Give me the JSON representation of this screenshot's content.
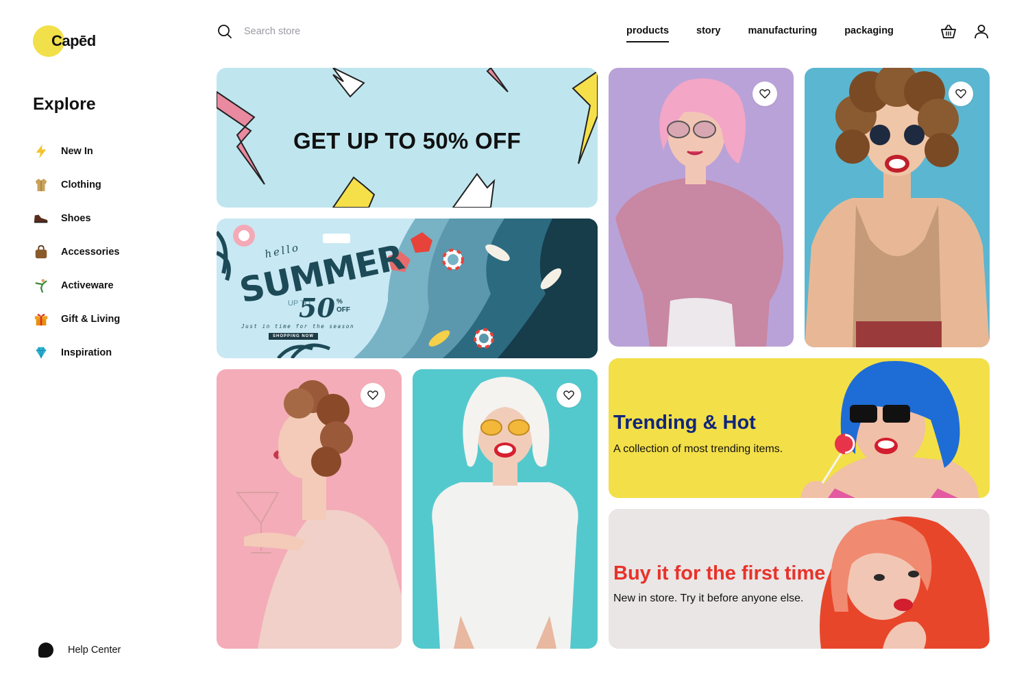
{
  "brand": {
    "logo_text": "Capēd",
    "accent_color": "#f2e04a"
  },
  "sidebar": {
    "heading": "Explore",
    "items": [
      {
        "label": "New In",
        "icon": "lightning-icon"
      },
      {
        "label": "Clothing",
        "icon": "coat-icon"
      },
      {
        "label": "Shoes",
        "icon": "shoe-icon"
      },
      {
        "label": "Accessories",
        "icon": "handbag-icon"
      },
      {
        "label": "Activeware",
        "icon": "gymnast-icon"
      },
      {
        "label": "Gift & Living",
        "icon": "gift-icon"
      },
      {
        "label": "Inspiration",
        "icon": "gem-icon"
      }
    ],
    "help": {
      "label": "Help Center",
      "icon": "chat-bubble-icon"
    }
  },
  "header": {
    "search": {
      "placeholder": "Search store",
      "value": ""
    },
    "nav": [
      {
        "label": "products",
        "active": true
      },
      {
        "label": "story",
        "active": false
      },
      {
        "label": "manufacturing",
        "active": false
      },
      {
        "label": "packaging",
        "active": false
      }
    ],
    "icons": [
      "basket-icon",
      "user-icon"
    ]
  },
  "banners": {
    "sale": {
      "title": "GET UP TO 50% OFF",
      "bg": "#bfe6ef"
    },
    "summer": {
      "hello": "hello",
      "title": "SUMMER",
      "upto": "UP TO",
      "percent": "50",
      "percent_sign": "%",
      "off": "OFF",
      "subtitle": "Just in time for the season",
      "cta": "SHOPPING NOW"
    },
    "trending": {
      "title": "Trending & Hot",
      "subtitle": "A collection of most trending items.",
      "title_color": "#10267a",
      "bg": "#f3df48"
    },
    "first_time": {
      "title": "Buy it for the first time",
      "subtitle": "New in store. Try it before anyone else.",
      "title_color": "#e8322a",
      "bg": "#e9e6e5"
    }
  },
  "products": [
    {
      "name": "pink-bob-sweater",
      "bg": "#b9a2d8"
    },
    {
      "name": "curly-hair-sequin-top",
      "bg": "#5bb6d1"
    },
    {
      "name": "pink-satin-robe",
      "bg": "#f4acb8"
    },
    {
      "name": "white-bob-tshirt",
      "bg": "#54c9cd"
    }
  ]
}
